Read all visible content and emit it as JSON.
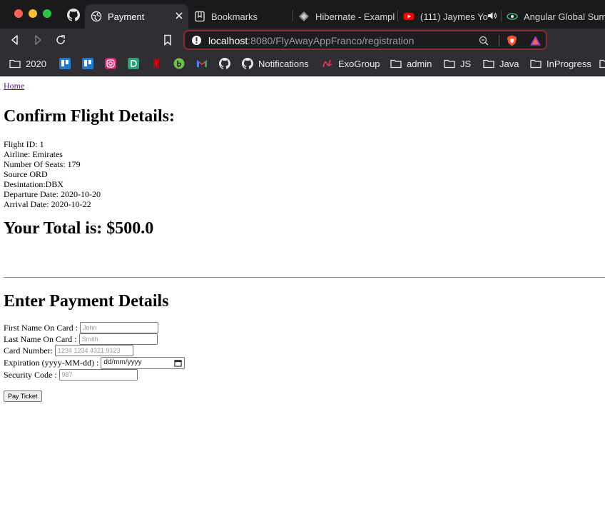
{
  "browser": {
    "tabs": [
      {
        "title": "Payment",
        "active": true,
        "icon": "globe-icon"
      },
      {
        "title": "Bookmarks",
        "active": false,
        "icon": "bookmarks-icon"
      },
      {
        "title": "Hibernate - Exampl",
        "active": false,
        "icon": "hibernate-icon"
      },
      {
        "title": "(111) Jaymes Yo",
        "active": false,
        "icon": "youtube-icon"
      },
      {
        "title": "Angular Global Sum",
        "active": false,
        "icon": "angular-icon"
      }
    ],
    "url": {
      "host": "localhost",
      "rest": ":8080/FlyAwayAppFranco/registration"
    },
    "bookmarks": [
      {
        "label": "2020",
        "icon": "folder-icon"
      },
      {
        "label": "",
        "icon": "trello-icon"
      },
      {
        "label": "",
        "icon": "trello-icon"
      },
      {
        "label": "",
        "icon": "instagram-icon"
      },
      {
        "label": "",
        "icon": "d-icon"
      },
      {
        "label": "",
        "icon": "netflix-icon"
      },
      {
        "label": "",
        "icon": "b-icon"
      },
      {
        "label": "",
        "icon": "gmail-icon"
      },
      {
        "label": "",
        "icon": "github-icon"
      },
      {
        "label": "Notifications",
        "icon": "github-icon"
      },
      {
        "label": "ExoGroup",
        "icon": "exo-icon"
      },
      {
        "label": "admin",
        "icon": "folder-icon"
      },
      {
        "label": "JS",
        "icon": "folder-icon"
      },
      {
        "label": "Java",
        "icon": "folder-icon"
      },
      {
        "label": "InProgress",
        "icon": "folder-icon"
      }
    ]
  },
  "page": {
    "home_link": "Home",
    "confirm_title": "Confirm Flight Details:",
    "details": [
      "Flight ID: 1",
      "Airline: Emirates",
      "Number Of Seats: 179",
      "Source ORD",
      "Desintation:DBX",
      "Departure Date: 2020-10-20",
      "Arrival Date: 2020-10-22"
    ],
    "total": "Your Total is: $500.0",
    "payment_title": "Enter Payment Details",
    "form": {
      "first_name_label": "First Name On Card :",
      "first_name_placeholder": "John",
      "last_name_label": "Last Name On Card :",
      "last_name_placeholder": "Smith",
      "card_number_label": "Card Number:",
      "card_number_placeholder": "1234 1234 4321 9123",
      "expiration_label": "Expiration (yyyy-MM-dd) :",
      "expiration_value": "dd/mm/yyyy",
      "security_label": "Security Code :",
      "security_placeholder": "987",
      "submit_label": "Pay Ticket"
    }
  }
}
